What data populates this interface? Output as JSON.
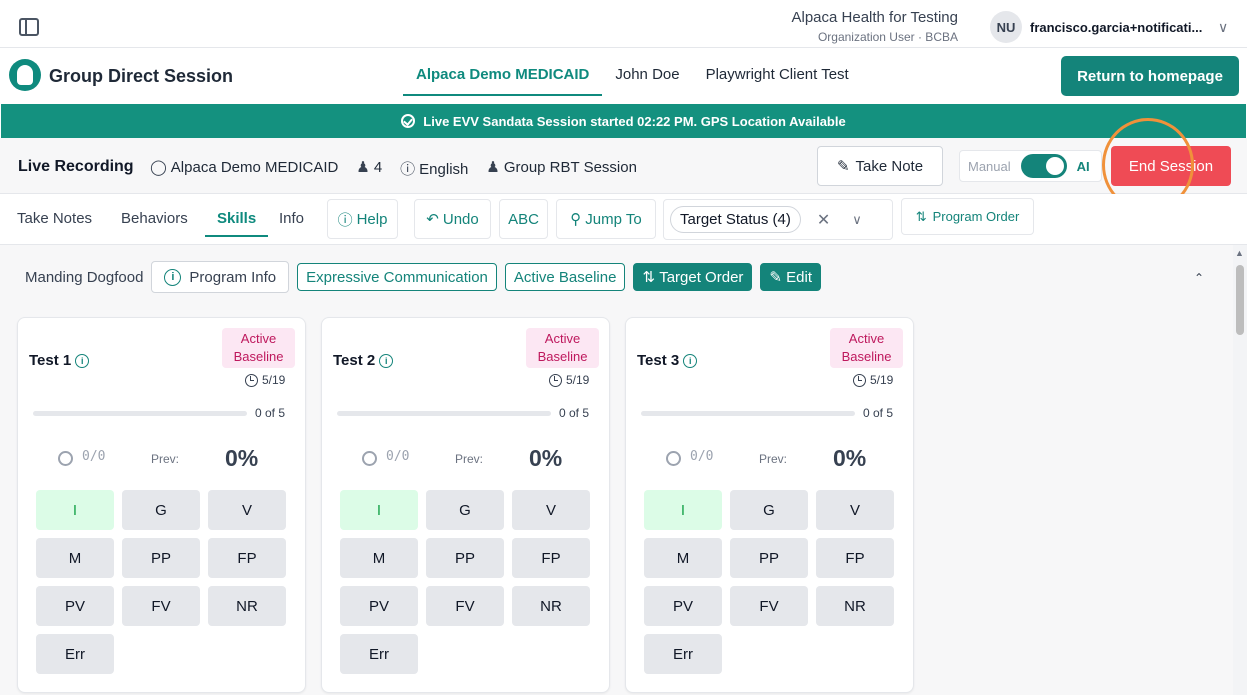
{
  "org": {
    "name": "Alpaca Health for Testing",
    "role": "Organization User · BCBA"
  },
  "user": {
    "initials": "NU",
    "email": "francisco.garcia+notificati..."
  },
  "header": {
    "title": "Group Direct Session",
    "clients": [
      "Alpaca Demo MEDICAID",
      "John Doe",
      "Playwright Client Test"
    ],
    "return_label": "Return to homepage"
  },
  "evv_banner": "Live EVV Sandata Session started 02:22 PM. GPS Location Available",
  "recording": {
    "title": "Live Recording",
    "client": "Alpaca Demo MEDICAID",
    "count": "4",
    "language": "English",
    "session_type": "Group RBT Session",
    "take_note": "Take Note",
    "mode_manual": "Manual",
    "mode_ai": "AI",
    "end_session": "End Session"
  },
  "toolbar": {
    "tabs": [
      "Take Notes",
      "Behaviors",
      "Skills",
      "Info"
    ],
    "active_tab": "Skills",
    "help": "Help",
    "undo": "Undo",
    "abc": "ABC",
    "jump_to": "Jump To",
    "target_status": "Target Status (4)",
    "program_order": "Program Order"
  },
  "program": {
    "name": "Manding Dogfood",
    "info_label": "Program Info",
    "tags": [
      "Expressive Communication",
      "Active Baseline"
    ],
    "target_order": "Target Order",
    "edit": "Edit"
  },
  "cards": [
    {
      "title": "Test 1",
      "badge": "Active Baseline",
      "date": "5/19",
      "progress_text": "0 of 5",
      "progress": 0,
      "ratio": "0/0",
      "prev_label": "Prev:",
      "percent": "0%"
    },
    {
      "title": "Test 2",
      "badge": "Active Baseline",
      "date": "5/19",
      "progress_text": "0 of 5",
      "progress": 0,
      "ratio": "0/0",
      "prev_label": "Prev:",
      "percent": "0%"
    },
    {
      "title": "Test 3",
      "badge": "Active Baseline",
      "date": "5/19",
      "progress_text": "0 of 5",
      "progress": 0,
      "ratio": "0/0",
      "prev_label": "Prev:",
      "percent": "0%"
    }
  ],
  "prompt_levels": [
    "I",
    "G",
    "V",
    "M",
    "PP",
    "FP",
    "PV",
    "FV",
    "NR",
    "Err"
  ],
  "colors": {
    "accent": "#14847a",
    "banner": "#14917f",
    "danger": "#ef4b55",
    "highlight": "#f0913a"
  }
}
